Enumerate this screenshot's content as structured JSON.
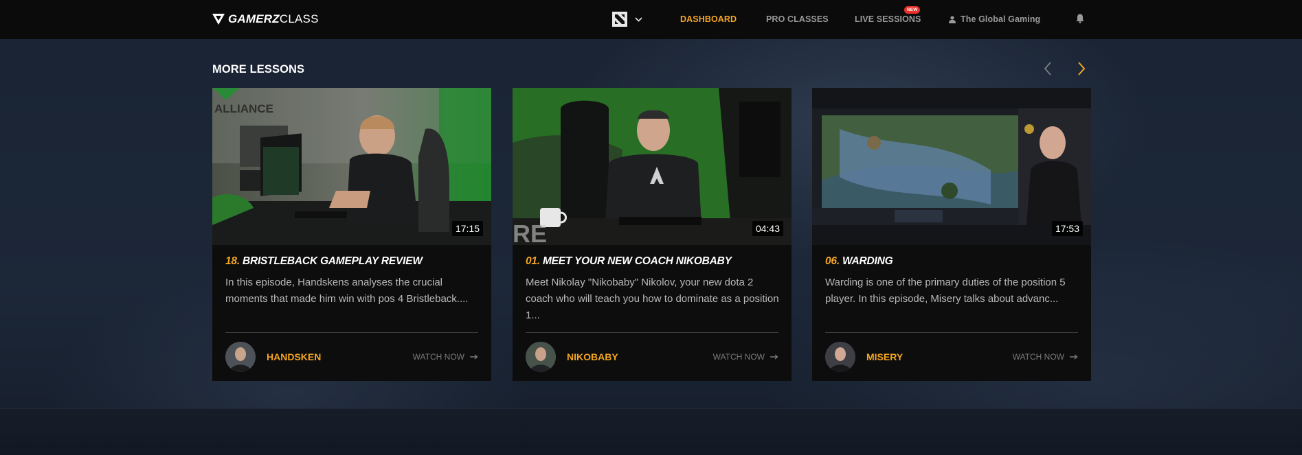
{
  "brand": {
    "logo_bold": "GAMERZ",
    "logo_light": "CLASS"
  },
  "nav": {
    "dashboard": "DASHBOARD",
    "pro_classes": "PRO CLASSES",
    "live_sessions": "LIVE SESSIONS",
    "new_badge": "NEW",
    "user": "The Global Gaming"
  },
  "icons": {
    "logo": "gamerzclass-logo-icon",
    "game": "dota2-icon",
    "dropdown": "chevron-down-icon",
    "user": "user-icon",
    "bell": "bell-icon",
    "prev": "chevron-left-icon",
    "next": "chevron-right-icon",
    "arrow": "arrow-right-icon"
  },
  "colors": {
    "accent": "#f5a623",
    "badge": "#e8322b",
    "bg": "#17202e",
    "card": "#0d0d0e"
  },
  "section": {
    "title": "MORE LESSONS"
  },
  "lessons": [
    {
      "number": "18.",
      "title": "BRISTLEBACK GAMEPLAY REVIEW",
      "duration": "17:15",
      "description": "In this episode, Handskens analyses the crucial moments that made him win with pos 4 Bristleback....",
      "coach": "HANDSKEN",
      "watch": "WATCH NOW"
    },
    {
      "number": "01.",
      "title": "MEET YOUR NEW COACH NIKOBABY",
      "duration": "04:43",
      "description": "Meet Nikolay \"Nikobaby\" Nikolov, your new dota 2 coach who will teach you how to dominate as a position 1...",
      "coach": "NIKOBABY",
      "watch": "WATCH NOW"
    },
    {
      "number": "06.",
      "title": "WARDING",
      "duration": "17:53",
      "description": "Warding is one of the primary duties of the position 5 player. In this episode, Misery talks about advanc...",
      "coach": "MISERY",
      "watch": "WATCH NOW"
    }
  ],
  "thumb_text": {
    "lesson_1_wall": "ALLIANCE"
  }
}
